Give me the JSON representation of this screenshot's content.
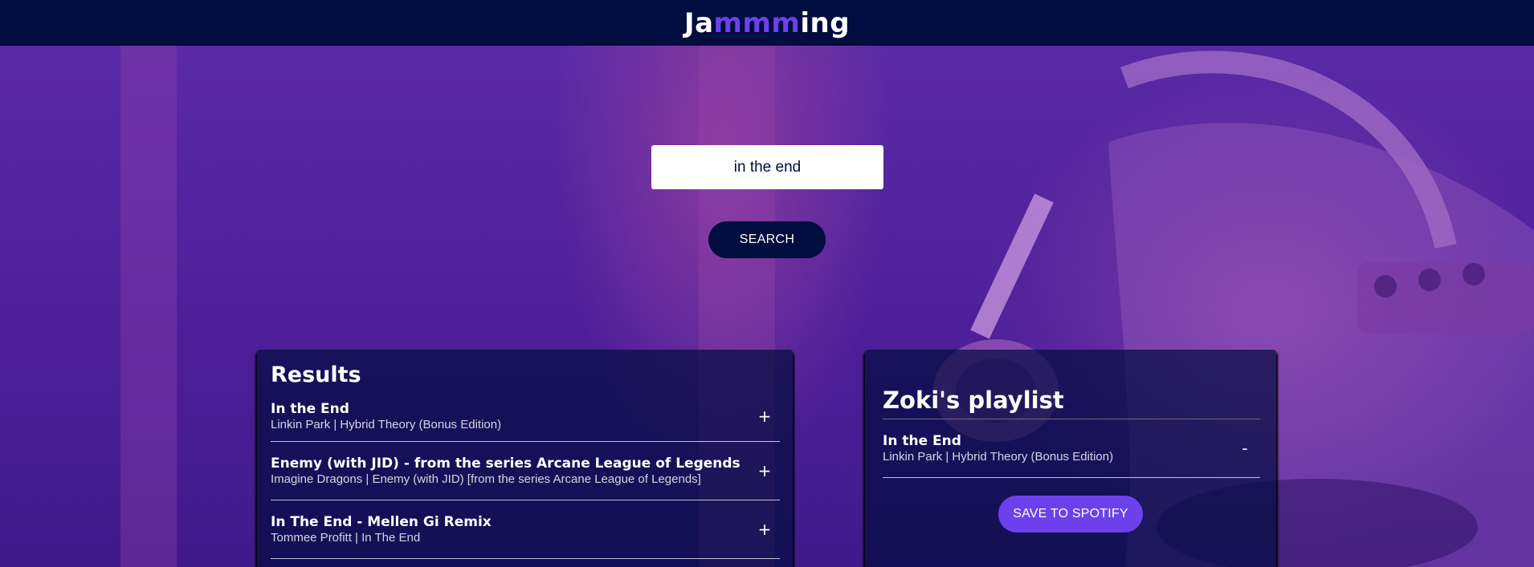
{
  "app": {
    "logo_prefix": "Ja",
    "logo_accent": "mmm",
    "logo_suffix": "ing"
  },
  "colors": {
    "header_bg": "#010c3f",
    "accent": "#6c41ec",
    "panel_bg": "rgba(1,12,63,0.7)"
  },
  "search": {
    "value": "in the end",
    "button_label": "SEARCH"
  },
  "results": {
    "title": "Results",
    "add_symbol": "+",
    "tracks": [
      {
        "name": "In the End",
        "meta": "Linkin Park | Hybrid Theory (Bonus Edition)"
      },
      {
        "name": "Enemy (with JID) - from the series Arcane League of Legends",
        "meta": "Imagine Dragons | Enemy (with JID) [from the series Arcane League of Legends]"
      },
      {
        "name": "In The End - Mellen Gi Remix",
        "meta": "Tommee Profitt | In The End"
      }
    ]
  },
  "playlist": {
    "name": "Zoki's playlist",
    "remove_symbol": "-",
    "tracks": [
      {
        "name": "In the End",
        "meta": "Linkin Park | Hybrid Theory (Bonus Edition)"
      }
    ],
    "save_label": "SAVE TO SPOTIFY"
  }
}
